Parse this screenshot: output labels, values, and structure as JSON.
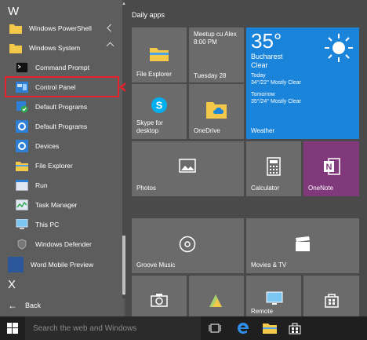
{
  "applist": {
    "letter_w": "W",
    "items": [
      {
        "label": "Windows PowerShell",
        "icon": "folder-icon"
      },
      {
        "label": "Windows System",
        "icon": "folder-icon"
      },
      {
        "label": "Command Prompt",
        "icon": "command-prompt-icon"
      },
      {
        "label": "Control Panel",
        "icon": "control-panel-icon"
      },
      {
        "label": "Default Programs",
        "icon": "default-programs-icon"
      },
      {
        "label": "Default Programs",
        "icon": "gear-icon"
      },
      {
        "label": "Devices",
        "icon": "gear-icon"
      },
      {
        "label": "File Explorer",
        "icon": "folder-icon"
      },
      {
        "label": "Run",
        "icon": "run-icon"
      },
      {
        "label": "Task Manager",
        "icon": "task-manager-icon"
      },
      {
        "label": "This PC",
        "icon": "computer-icon"
      },
      {
        "label": "Windows Defender",
        "icon": "shield-icon"
      },
      {
        "label": "Word Mobile Preview",
        "icon": "word-icon"
      }
    ],
    "letter_x": "X",
    "back_label": "Back"
  },
  "tiles": {
    "group_label": "Daily apps",
    "file_explorer": "File Explorer",
    "calendar": {
      "line1": "Meetup cu Alex",
      "line2": "8:00 PM",
      "date": "Tuesday 28"
    },
    "weather": {
      "temp": "35°",
      "city": "Bucharest",
      "condition": "Clear",
      "today_label": "Today",
      "today": "34°/22° Mostly Clear",
      "tomorrow_label": "Tomorrow",
      "tomorrow": "35°/24° Mostly Clear",
      "app": "Weather"
    },
    "skype": "Skype for desktop",
    "onedrive": "OneDrive",
    "photos": "Photos",
    "calculator": "Calculator",
    "onenote": "OneNote",
    "groove": "Groove Music",
    "movies": "Movies & TV",
    "remote": "Remote"
  },
  "taskbar": {
    "search_placeholder": "Search the web and Windows"
  },
  "colors": {
    "accent": "#1a84da",
    "onenote": "#80397b",
    "annotation": "#e8202a",
    "tile": "#6b6b6b"
  }
}
